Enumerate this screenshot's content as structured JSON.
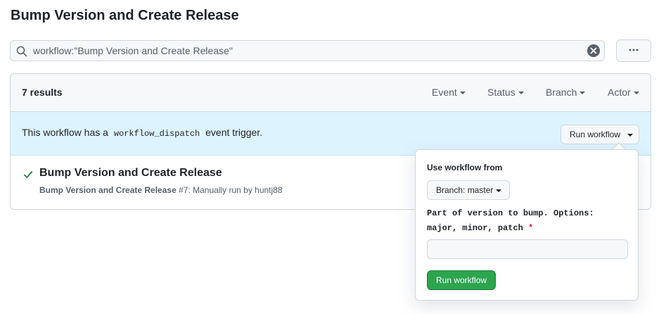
{
  "page": {
    "title": "Bump Version and Create Release"
  },
  "search": {
    "value": "workflow:\"Bump Version and Create Release\""
  },
  "icons": {
    "search": "search-icon",
    "clear": "x-circle-fill-icon",
    "more": "kebab-horizontal-icon",
    "caret": "triangle-down-icon",
    "check": "check-icon"
  },
  "results": {
    "count_label": "7 results",
    "filters": [
      "Event",
      "Status",
      "Branch",
      "Actor"
    ]
  },
  "banner": {
    "text_before": "This workflow has a",
    "code": "workflow_dispatch",
    "text_after": "event trigger.",
    "run_button_label": "Run workflow"
  },
  "runs": [
    {
      "title": "Bump Version and Create Release",
      "workflow": "Bump Version and Create Release",
      "number": "#7",
      "meta": ": Manually run by huntj88",
      "status": "success"
    }
  ],
  "popover": {
    "use_from_label": "Use workflow from",
    "branch_label": "Branch: master",
    "input_label_line1": "Part of version to bump. Options:",
    "input_label_line2": "major, minor, patch",
    "required_marker": "*",
    "input_value": "",
    "submit_label": "Run workflow"
  },
  "colors": {
    "accent_green": "#2da44e",
    "banner_bg": "#ddf4ff",
    "required_red": "#cf222e",
    "success_check": "#1a7f37"
  }
}
